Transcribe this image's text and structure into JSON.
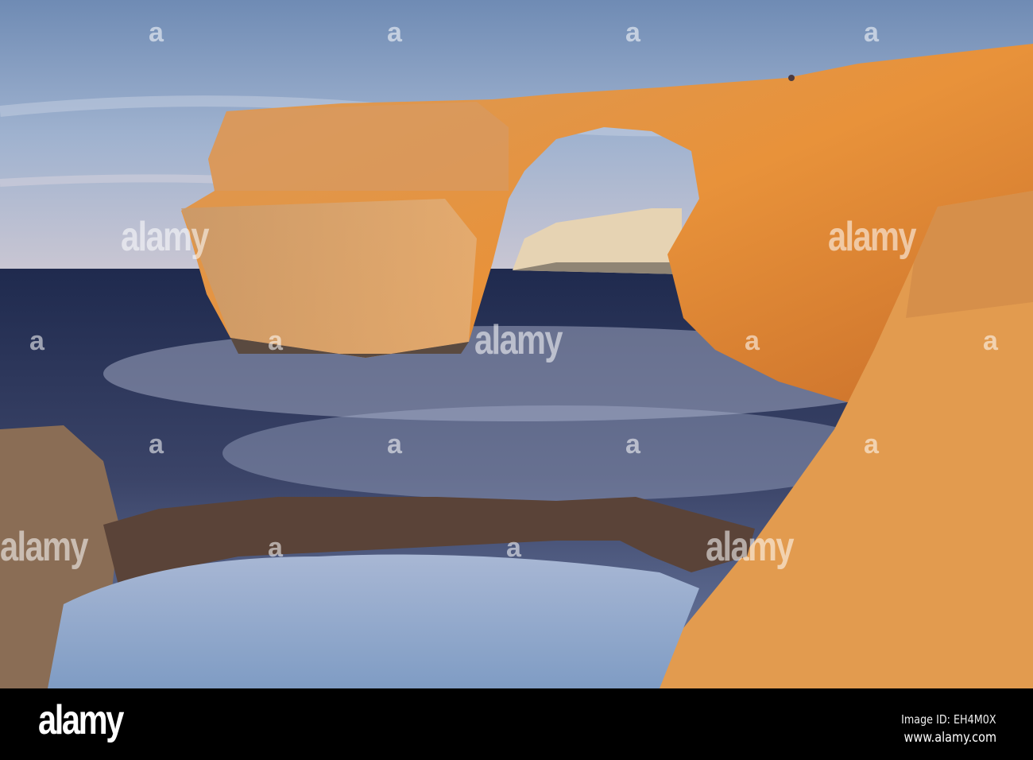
{
  "photo": {
    "subject": "Azure Window sea arch at sunset",
    "colors": {
      "sky": "#8ea6c6",
      "sea": "#2a3558",
      "rock": "#e39a3e",
      "mist": "#b9c3dc"
    }
  },
  "watermark": {
    "small": "a",
    "large": "alamy"
  },
  "footer": {
    "logo": "alamy",
    "image_id": "Image ID: EH4M0X",
    "url": "www.alamy.com"
  }
}
